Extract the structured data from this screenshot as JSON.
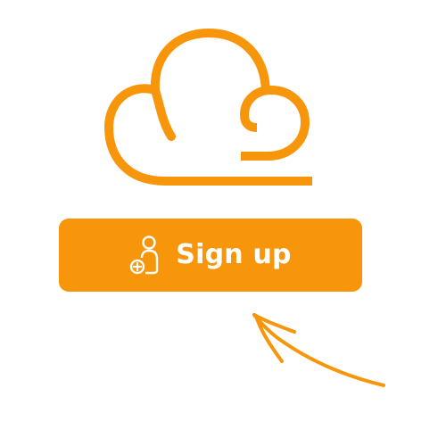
{
  "colors": {
    "accent": "#F7960B",
    "button_text": "#FFFFFF",
    "background": "#FFFFFF"
  },
  "logo": {
    "icon": "cloud-icon"
  },
  "signup_button": {
    "icon": "add-user-icon",
    "label": "Sign up"
  },
  "annotation": {
    "icon": "hand-drawn-arrow-icon"
  }
}
